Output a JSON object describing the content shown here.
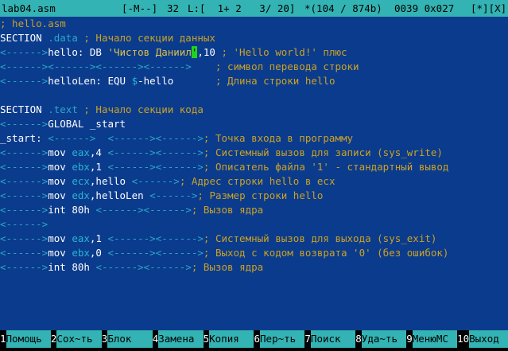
{
  "status": {
    "filename": "lab04.asm",
    "mode": "[-M--]",
    "col": "32",
    "line_info": "L:[  1+ 2   3/ 20]",
    "bytes": "*(104 / 874b)",
    "char_code": "0039 0x027",
    "flags": "[*][X]"
  },
  "editor": {
    "lines": [
      [
        {
          "t": "; hello.asm",
          "c": "cmt"
        }
      ],
      [
        {
          "t": "SECTION",
          "c": "w"
        },
        {
          "t": " .data",
          "c": "sec"
        },
        {
          "t": " ; Начало секции данных",
          "c": "cmt"
        }
      ],
      [
        {
          "t": "<------>",
          "c": "tab"
        },
        {
          "t": "hello: DB ",
          "c": "w"
        },
        {
          "t": "'Чистов Даниил",
          "c": "str"
        },
        {
          "t": "'",
          "c": "cursor"
        },
        {
          "t": ",10",
          "c": "w"
        },
        {
          "t": " ; 'Hello world!' плюс",
          "c": "cmt"
        }
      ],
      [
        {
          "t": "<------><------><------><------>",
          "c": "tab"
        },
        {
          "t": "    ; символ перевода строки",
          "c": "cmt"
        }
      ],
      [
        {
          "t": "<------>",
          "c": "tab"
        },
        {
          "t": "helloLen: EQU ",
          "c": "w"
        },
        {
          "t": "$",
          "c": "reg"
        },
        {
          "t": "-hello       ",
          "c": "w"
        },
        {
          "t": "; Длина строки hello",
          "c": "cmt"
        }
      ],
      [
        {
          "t": "",
          "c": "w"
        }
      ],
      [
        {
          "t": "SECTION",
          "c": "w"
        },
        {
          "t": " .text",
          "c": "sec"
        },
        {
          "t": " ; Начало секции кода",
          "c": "cmt"
        }
      ],
      [
        {
          "t": "<------>",
          "c": "tab"
        },
        {
          "t": "GLOBAL _start",
          "c": "w"
        }
      ],
      [
        {
          "t": "_start: ",
          "c": "w"
        },
        {
          "t": "<------>  <------><------>",
          "c": "tab"
        },
        {
          "t": "; Точка входа в программу",
          "c": "cmt"
        }
      ],
      [
        {
          "t": "<------>",
          "c": "tab"
        },
        {
          "t": "mov ",
          "c": "w"
        },
        {
          "t": "eax",
          "c": "reg"
        },
        {
          "t": ",4 ",
          "c": "w"
        },
        {
          "t": "<------><------>",
          "c": "tab"
        },
        {
          "t": "; Системный вызов для записи (sys_write)",
          "c": "cmt"
        }
      ],
      [
        {
          "t": "<------>",
          "c": "tab"
        },
        {
          "t": "mov ",
          "c": "w"
        },
        {
          "t": "ebx",
          "c": "reg"
        },
        {
          "t": ",1 ",
          "c": "w"
        },
        {
          "t": "<------><------>",
          "c": "tab"
        },
        {
          "t": "; Описатель файла '1' - стандартный вывод",
          "c": "cmt"
        }
      ],
      [
        {
          "t": "<------>",
          "c": "tab"
        },
        {
          "t": "mov ",
          "c": "w"
        },
        {
          "t": "ecx",
          "c": "reg"
        },
        {
          "t": ",hello ",
          "c": "w"
        },
        {
          "t": "<------>",
          "c": "tab"
        },
        {
          "t": "; Адрес строки hello в ecx",
          "c": "cmt"
        }
      ],
      [
        {
          "t": "<------>",
          "c": "tab"
        },
        {
          "t": "mov ",
          "c": "w"
        },
        {
          "t": "edx",
          "c": "reg"
        },
        {
          "t": ",helloLen ",
          "c": "w"
        },
        {
          "t": "<------>",
          "c": "tab"
        },
        {
          "t": "; Размер строки hello",
          "c": "cmt"
        }
      ],
      [
        {
          "t": "<------>",
          "c": "tab"
        },
        {
          "t": "int 80h ",
          "c": "w"
        },
        {
          "t": "<------><------>",
          "c": "tab"
        },
        {
          "t": "; Вызов ядра",
          "c": "cmt"
        }
      ],
      [
        {
          "t": "<------>",
          "c": "tab"
        }
      ],
      [
        {
          "t": "<------>",
          "c": "tab"
        },
        {
          "t": "mov ",
          "c": "w"
        },
        {
          "t": "eax",
          "c": "reg"
        },
        {
          "t": ",1 ",
          "c": "w"
        },
        {
          "t": "<------><------>",
          "c": "tab"
        },
        {
          "t": "; Системный вызов для выхода (sys_exit)",
          "c": "cmt"
        }
      ],
      [
        {
          "t": "<------>",
          "c": "tab"
        },
        {
          "t": "mov ",
          "c": "w"
        },
        {
          "t": "ebx",
          "c": "reg"
        },
        {
          "t": ",0 ",
          "c": "w"
        },
        {
          "t": "<------><------>",
          "c": "tab"
        },
        {
          "t": "; Выход с кодом возврата '0' (без ошибок)",
          "c": "cmt"
        }
      ],
      [
        {
          "t": "<------>",
          "c": "tab"
        },
        {
          "t": "int 80h ",
          "c": "w"
        },
        {
          "t": "<------><------>",
          "c": "tab"
        },
        {
          "t": "; Вызов ядра",
          "c": "cmt"
        }
      ]
    ]
  },
  "keys": [
    {
      "num": "1",
      "label": "Помощь"
    },
    {
      "num": "2",
      "label": "Сох~ть"
    },
    {
      "num": "3",
      "label": "Блок"
    },
    {
      "num": "4",
      "label": "Замена"
    },
    {
      "num": "5",
      "label": "Копия"
    },
    {
      "num": "6",
      "label": "Пер~ть"
    },
    {
      "num": "7",
      "label": "Поиск"
    },
    {
      "num": "8",
      "label": "Уда~ть"
    },
    {
      "num": "9",
      "label": "МенюMC"
    },
    {
      "num": "10",
      "label": "Выход"
    }
  ]
}
